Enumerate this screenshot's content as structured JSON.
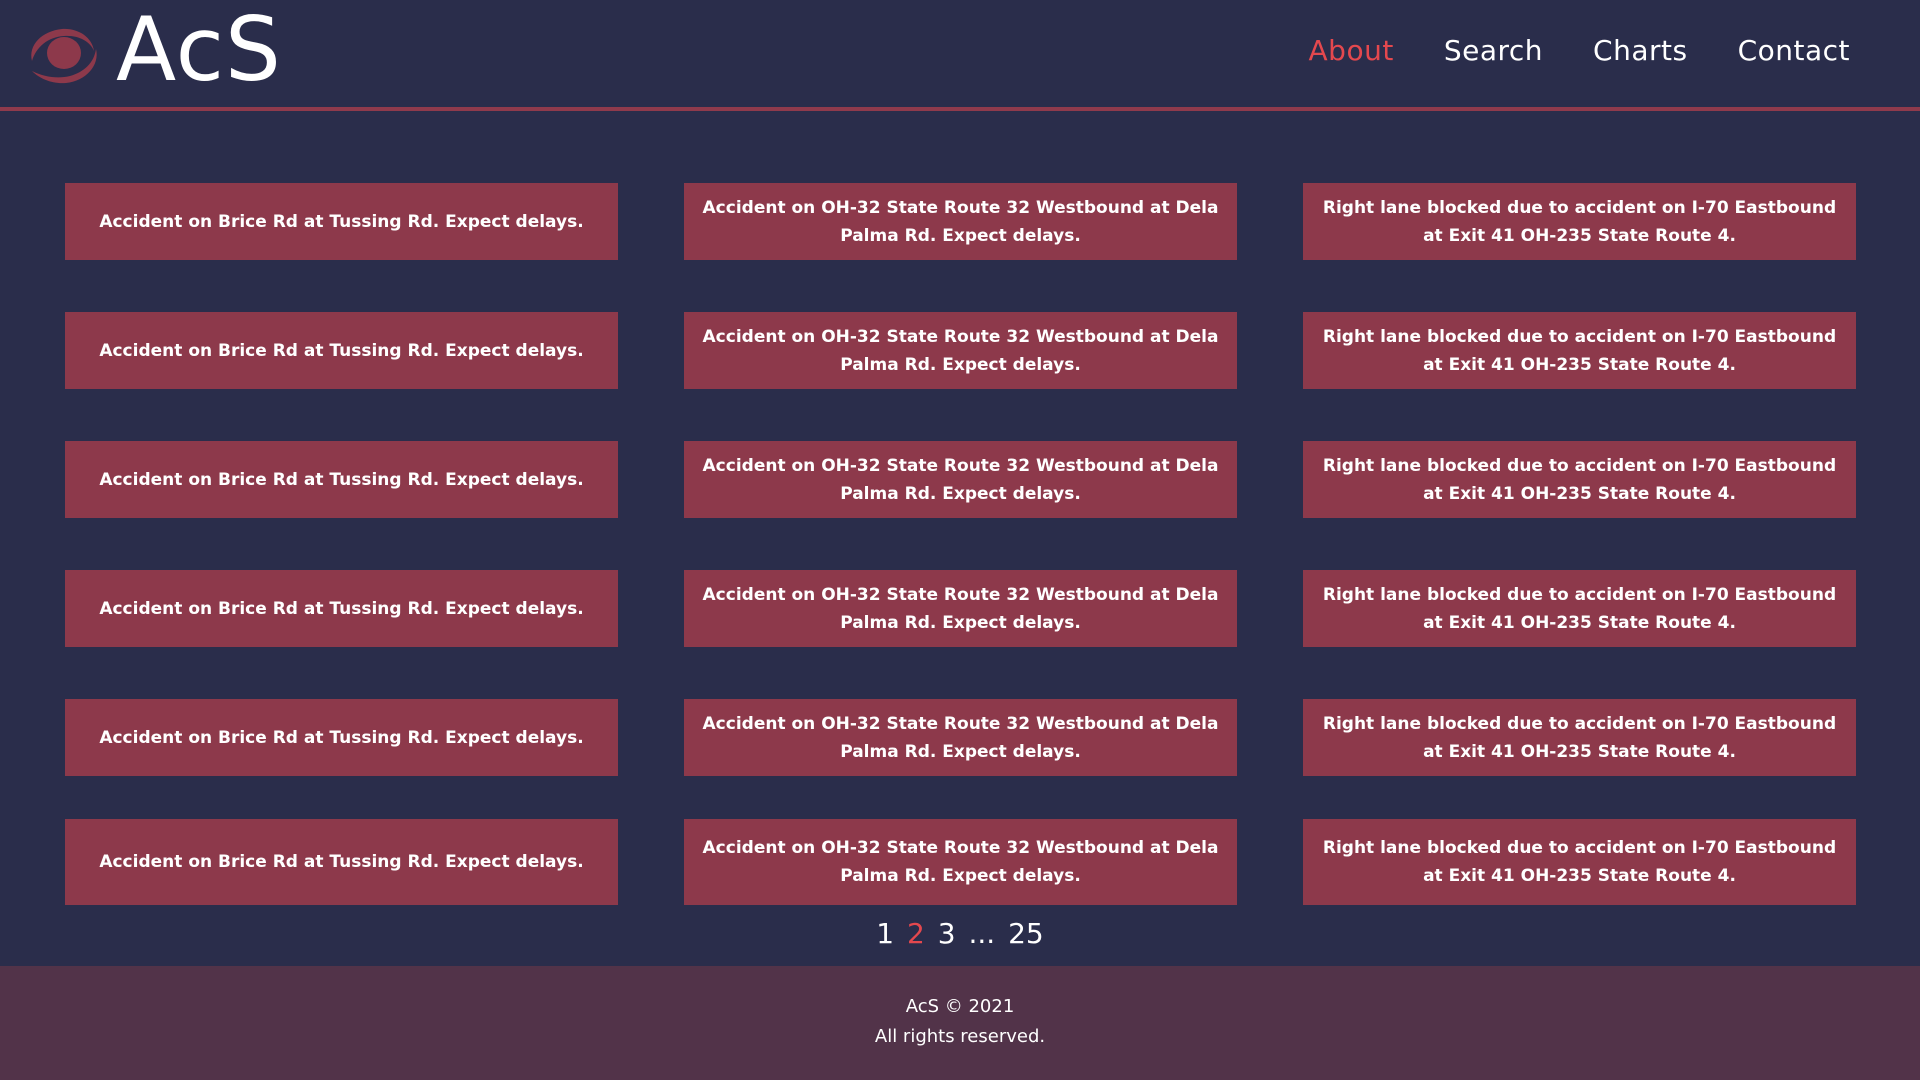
{
  "brand": {
    "name": "AcS",
    "logo_icon": "eye-swirl-icon",
    "accent_color": "#e4484e",
    "card_color": "#8d394b",
    "background_color": "#2a2d4b",
    "footer_color": "#523349"
  },
  "nav": {
    "items": [
      {
        "label": "About",
        "active": true
      },
      {
        "label": "Search",
        "active": false
      },
      {
        "label": "Charts",
        "active": false
      },
      {
        "label": "Contact",
        "active": false
      }
    ]
  },
  "cards": [
    {
      "text": "Accident on Brice Rd at Tussing Rd. Expect delays."
    },
    {
      "text": "Accident on OH-32 State Route 32 Westbound at Dela Palma Rd. Expect delays."
    },
    {
      "text": "Right lane blocked due to accident on I-70 Eastbound at Exit 41 OH-235 State Route 4."
    },
    {
      "text": "Accident on Brice Rd at Tussing Rd. Expect delays."
    },
    {
      "text": "Accident on OH-32 State Route 32 Westbound at Dela Palma Rd. Expect delays."
    },
    {
      "text": "Right lane blocked due to accident on I-70 Eastbound at Exit 41 OH-235 State Route 4."
    },
    {
      "text": "Accident on Brice Rd at Tussing Rd. Expect delays."
    },
    {
      "text": "Accident on OH-32 State Route 32 Westbound at Dela Palma Rd. Expect delays."
    },
    {
      "text": "Right lane blocked due to accident on I-70 Eastbound at Exit 41 OH-235 State Route 4."
    },
    {
      "text": "Accident on Brice Rd at Tussing Rd. Expect delays."
    },
    {
      "text": "Accident on OH-32 State Route 32 Westbound at Dela Palma Rd. Expect delays."
    },
    {
      "text": "Right lane blocked due to accident on I-70 Eastbound at Exit 41 OH-235 State Route 4."
    },
    {
      "text": "Accident on Brice Rd at Tussing Rd. Expect delays."
    },
    {
      "text": "Accident on OH-32 State Route 32 Westbound at Dela Palma Rd. Expect delays."
    },
    {
      "text": "Right lane blocked due to accident on I-70 Eastbound at Exit 41 OH-235 State Route 4."
    },
    {
      "text": "Accident on Brice Rd at Tussing Rd. Expect delays."
    },
    {
      "text": "Accident on OH-32 State Route 32 Westbound at Dela Palma Rd. Expect delays."
    },
    {
      "text": "Right lane blocked due to accident on I-70 Eastbound at Exit 41 OH-235 State Route 4."
    }
  ],
  "pagination": {
    "pages": [
      "1",
      "2",
      "3",
      "...",
      "25"
    ],
    "current": "2"
  },
  "footer": {
    "copyright": "AcS © 2021",
    "rights": "All rights reserved."
  }
}
